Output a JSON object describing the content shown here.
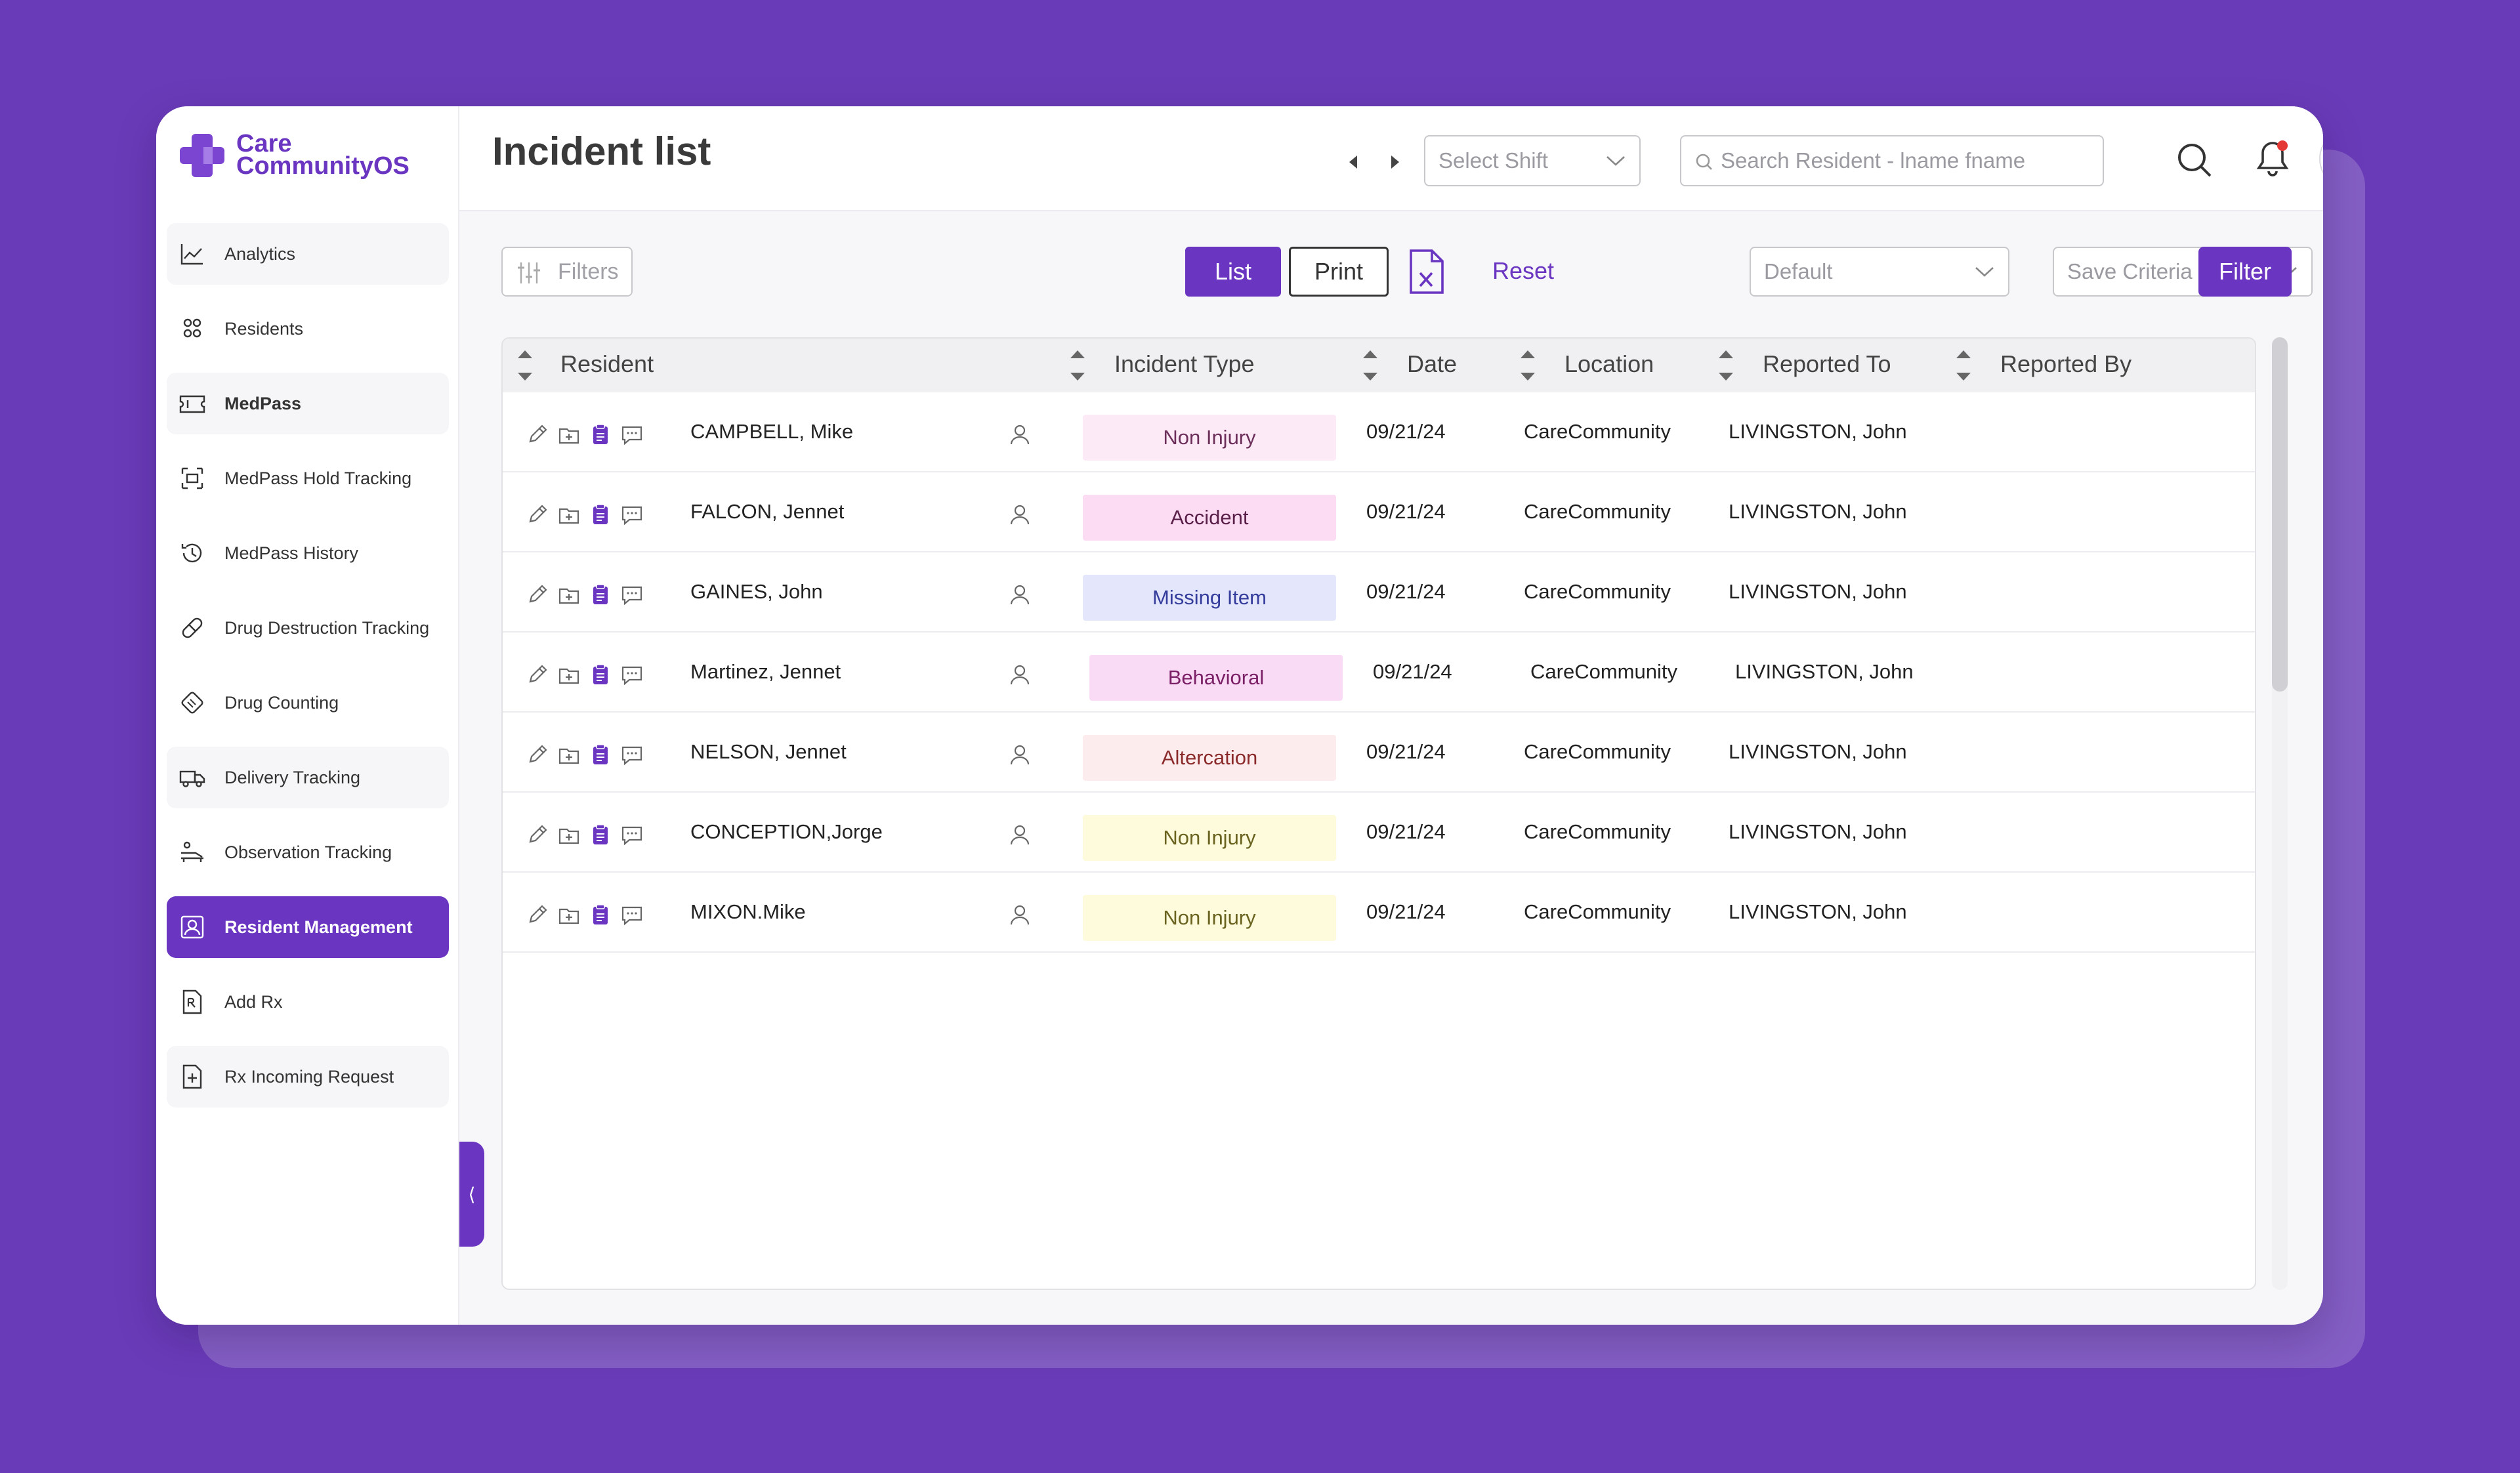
{
  "app": {
    "brand_line1": "Care",
    "brand_line2": "CommunityOS"
  },
  "header": {
    "title": "Incident list",
    "shift_placeholder": "Select Shift",
    "search_placeholder": "Search Resident - lname fname"
  },
  "sidebar": {
    "items": [
      {
        "label": "Analytics",
        "icon": "chart-line-icon"
      },
      {
        "label": "Residents",
        "icon": "users-icon"
      },
      {
        "label": "MedPass",
        "icon": "ticket-icon"
      },
      {
        "label": "MedPass Hold Tracking",
        "icon": "hold-icon"
      },
      {
        "label": "MedPass History",
        "icon": "history-icon"
      },
      {
        "label": "Drug Destruction Tracking",
        "icon": "pill-icon"
      },
      {
        "label": "Drug Counting",
        "icon": "tablet-icon"
      },
      {
        "label": "Delivery Tracking",
        "icon": "truck-icon"
      },
      {
        "label": "Observation Tracking",
        "icon": "observation-icon"
      },
      {
        "label": "Resident Management",
        "icon": "resident-card-icon"
      },
      {
        "label": "Add Rx",
        "icon": "rx-file-icon"
      },
      {
        "label": "Rx Incoming Request",
        "icon": "file-plus-icon"
      }
    ]
  },
  "toolbar": {
    "filters_label": "Filters",
    "list_label": "List",
    "print_label": "Print",
    "reset_label": "Reset",
    "default_placeholder": "Default",
    "save_criteria_placeholder": "Save Criteria",
    "filter_label": "Filter"
  },
  "table": {
    "columns": [
      "Resident",
      "Incident Type",
      "Date",
      "Location",
      "Reported To",
      "Reported By"
    ],
    "rows": [
      {
        "resident": "CAMPBELL, Mike",
        "type": "Non Injury",
        "date": "09/21/24",
        "location": "CareCommunity",
        "reported_to": "LIVINGSTON, John",
        "reported_by": ""
      },
      {
        "resident": "FALCON, Jennet",
        "type": "Accident",
        "date": "09/21/24",
        "location": "CareCommunity",
        "reported_to": "LIVINGSTON, John",
        "reported_by": ""
      },
      {
        "resident": "GAINES, John",
        "type": "Missing Item",
        "date": "09/21/24",
        "location": "CareCommunity",
        "reported_to": "LIVINGSTON, John",
        "reported_by": ""
      },
      {
        "resident": "Martinez, Jennet",
        "type": "Behavioral",
        "date": "09/21/24",
        "location": "CareCommunity",
        "reported_to": "LIVINGSTON, John",
        "reported_by": ""
      },
      {
        "resident": "NELSON, Jennet",
        "type": "Altercation",
        "date": "09/21/24",
        "location": "CareCommunity",
        "reported_to": "LIVINGSTON, John",
        "reported_by": ""
      },
      {
        "resident": "CONCEPTION,Jorge",
        "type": "Non Injury",
        "date": "09/21/24",
        "location": "CareCommunity",
        "reported_to": "LIVINGSTON, John",
        "reported_by": ""
      },
      {
        "resident": "MIXON.Mike",
        "type": "Non Injury",
        "date": "09/21/24",
        "location": "CareCommunity",
        "reported_to": "LIVINGSTON, John",
        "reported_by": ""
      }
    ]
  },
  "colors": {
    "accent": "#6a35c0",
    "background": "#6a3bb8",
    "badge_non_injury_pink": "#fdeaf7",
    "badge_accident": "#fbdcf3",
    "badge_missing_item": "#e4e6fb",
    "badge_behavioral": "#fadbf5",
    "badge_altercation": "#fdecee",
    "badge_non_injury_yellow": "#fdfbdc"
  }
}
